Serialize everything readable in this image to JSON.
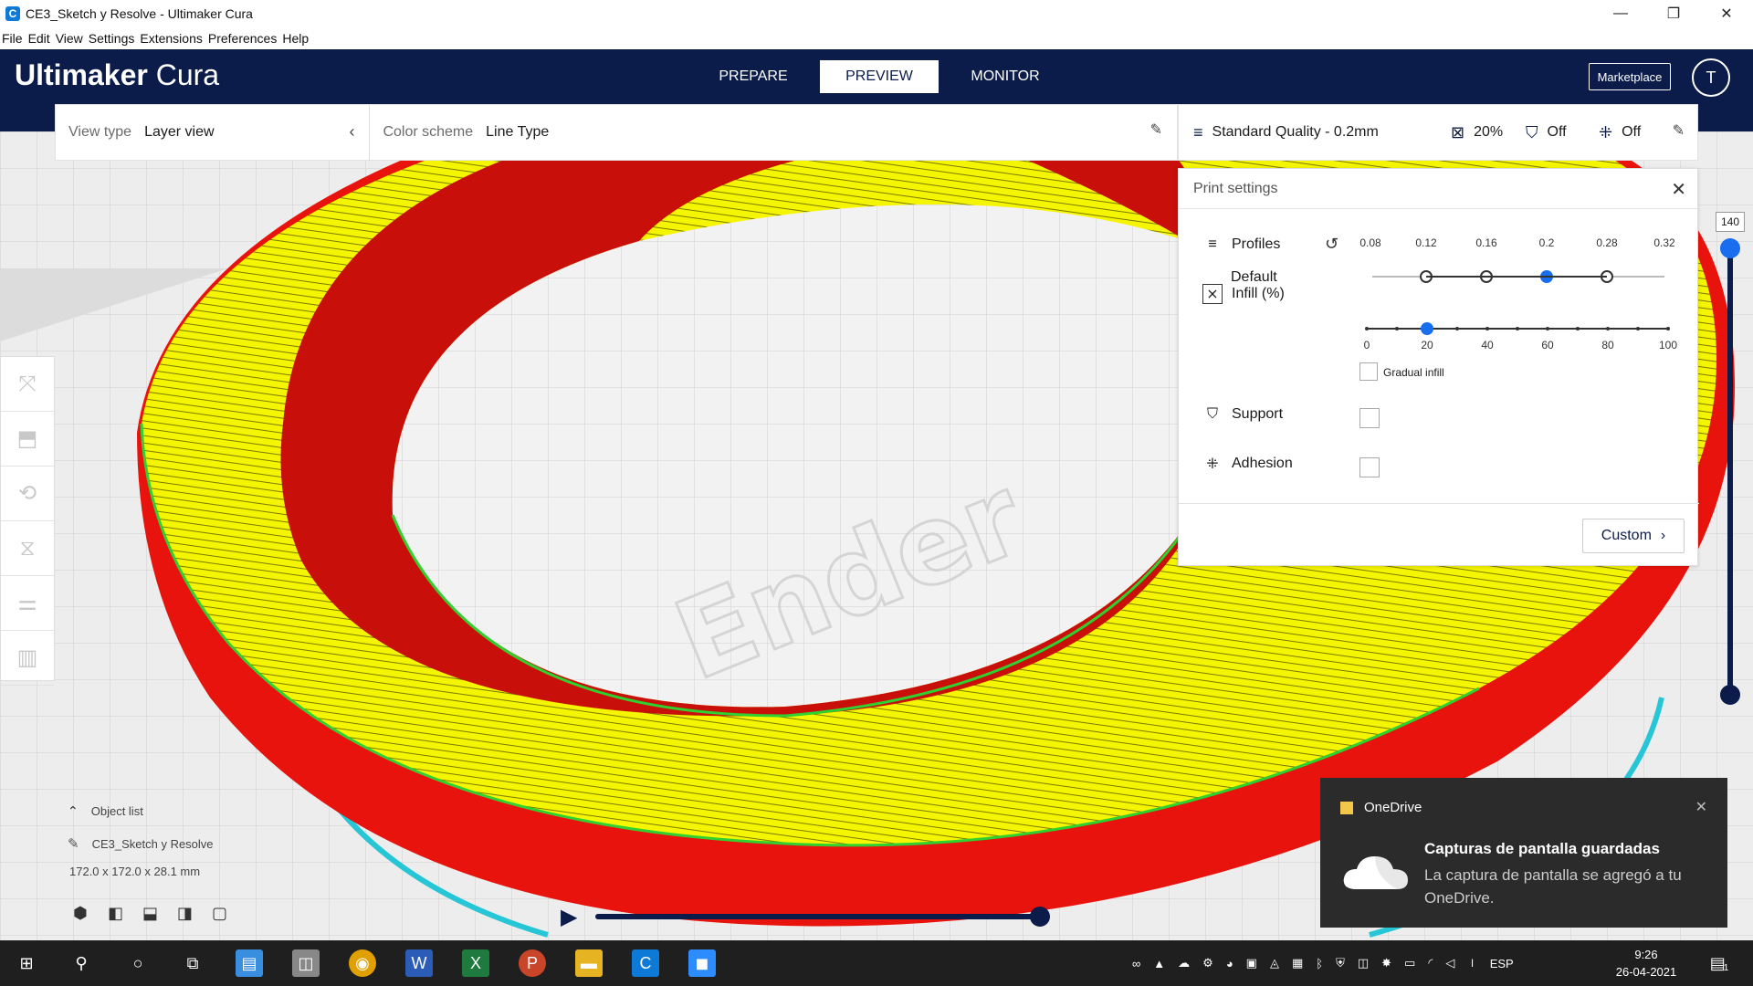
{
  "window": {
    "title": "CE3_Sketch y Resolve - Ultimaker Cura",
    "app_icon": "C",
    "minimize": "—",
    "maximize": "❐",
    "close": "✕"
  },
  "menu": [
    "File",
    "Edit",
    "View",
    "Settings",
    "Extensions",
    "Preferences",
    "Help"
  ],
  "header": {
    "logo_bold": "Ultimaker",
    "logo_light": " Cura",
    "stages": [
      "PREPARE",
      "PREVIEW",
      "MONITOR"
    ],
    "marketplace": "Marketplace",
    "account_initial": "T"
  },
  "view_panel": {
    "view_type_label": "View type",
    "view_type_value": "Layer view",
    "color_scheme_label": "Color scheme",
    "color_scheme_value": "Line Type"
  },
  "print_panel": {
    "profile": "Standard Quality - 0.2mm",
    "infill": "20%",
    "support": "Off",
    "adhesion": "Off"
  },
  "print_settings": {
    "title": "Print settings",
    "profiles_label": "Profiles",
    "profile_name": "Default",
    "layer_heights": [
      "0.08",
      "0.12",
      "0.16",
      "0.2",
      "0.28",
      "0.32"
    ],
    "selected_layer_height": "0.2",
    "infill_label": "Infill (%)",
    "infill_ticks": [
      "0",
      "20",
      "40",
      "60",
      "80",
      "100"
    ],
    "infill_value": 20,
    "gradual_infill": "Gradual infill",
    "support_label": "Support",
    "adhesion_label": "Adhesion",
    "custom_button": "Custom"
  },
  "layer_slider": {
    "value": "140"
  },
  "object_list": {
    "title": "Object list",
    "object_name": "CE3_Sketch y Resolve",
    "dimensions": "172.0 x 172.0 x 28.1 mm"
  },
  "toast": {
    "app": "OneDrive",
    "title": "Capturas de pantalla guardadas",
    "body": "La captura de pantalla se agregó a tu OneDrive."
  },
  "taskbar": {
    "language": "ESP",
    "time": "9:26",
    "date": "26-04-2021",
    "notification_count": "1"
  },
  "colors": {
    "header_bg": "#0b1c4a",
    "accent_blue": "#196ef0",
    "wall_red": "#e8130c",
    "skin_yellow": "#f2f500",
    "support_cyan": "#27c6d6"
  }
}
